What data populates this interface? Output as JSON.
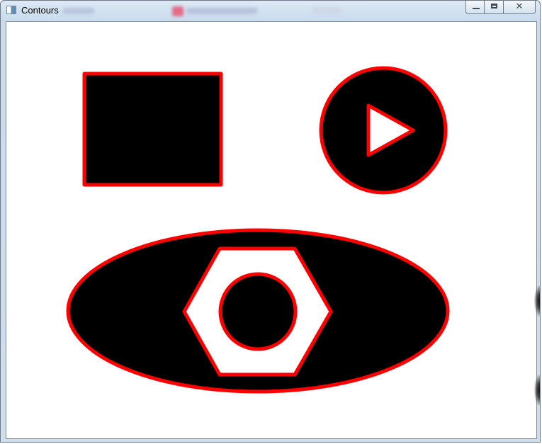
{
  "window": {
    "title": "Contours",
    "icon": "app-window-icon",
    "controls": {
      "minimize": "minimize-icon",
      "maximize": "maximize-icon",
      "close": "close-icon",
      "close_glyph": "✕"
    }
  },
  "canvas": {
    "background": "#ffffff",
    "fill_color": "#000000",
    "contour_color": "#ff0000"
  }
}
